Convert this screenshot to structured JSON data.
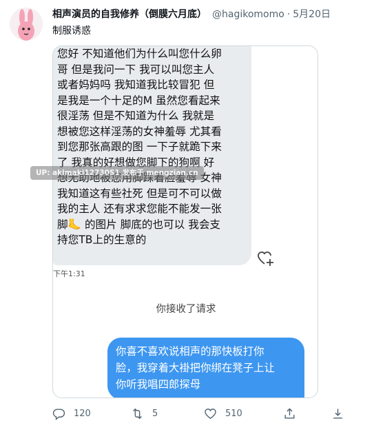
{
  "author": {
    "display_name": "相声演员的自我修养（倒膜六月底）",
    "handle": "@hagikomomo",
    "separator": "·",
    "date": "5月20日"
  },
  "tweet": {
    "text": "制服诱惑"
  },
  "media": {
    "incoming_lines": [
      "您好 不知道他们为什么叫您什么卵",
      "哥 但是我问一下 我可以叫您主人",
      "或者妈妈吗 我知道我比较冒犯 但",
      "是我是一个十足的M 虽然您看起来",
      "很淫荡 但是不知道为什么 我就是",
      "想被您这样淫荡的女神羞辱 尤其看",
      "到您那张高跟的图 一下子就跪下来",
      "了 我真的好想做您脚下的狗啊 好",
      "想无助地被您用脚踩着脸羞辱 女神",
      "我知道这有些社死 但是可不可以做",
      "我的主人 还有求求您能不能发一张",
      "脚🦶 的图片 脚底的也可以 我会支",
      "持您TB上的生意的"
    ],
    "message_time": "下午1:31",
    "system_note": "你接收了请求",
    "outgoing_lines": [
      "你喜不喜欢说相声的那快板打你",
      "脸，我穿着大褂把你绑在凳子上让",
      "你听我唱四郎探母"
    ],
    "watermark": "UP: akimaki12730S1 发布于 mengzian.cn"
  },
  "actions": {
    "reply_count": "120",
    "retweet_count": "5",
    "like_count": "510"
  },
  "colors": {
    "outgoing_bubble": "#3d96f0",
    "incoming_bubble": "#e9ecef",
    "secondary_text": "#536471"
  },
  "icons": [
    "avatar-rabbit",
    "heart-add-icon",
    "reply-icon",
    "retweet-icon",
    "like-icon",
    "share-icon",
    "download-icon"
  ]
}
